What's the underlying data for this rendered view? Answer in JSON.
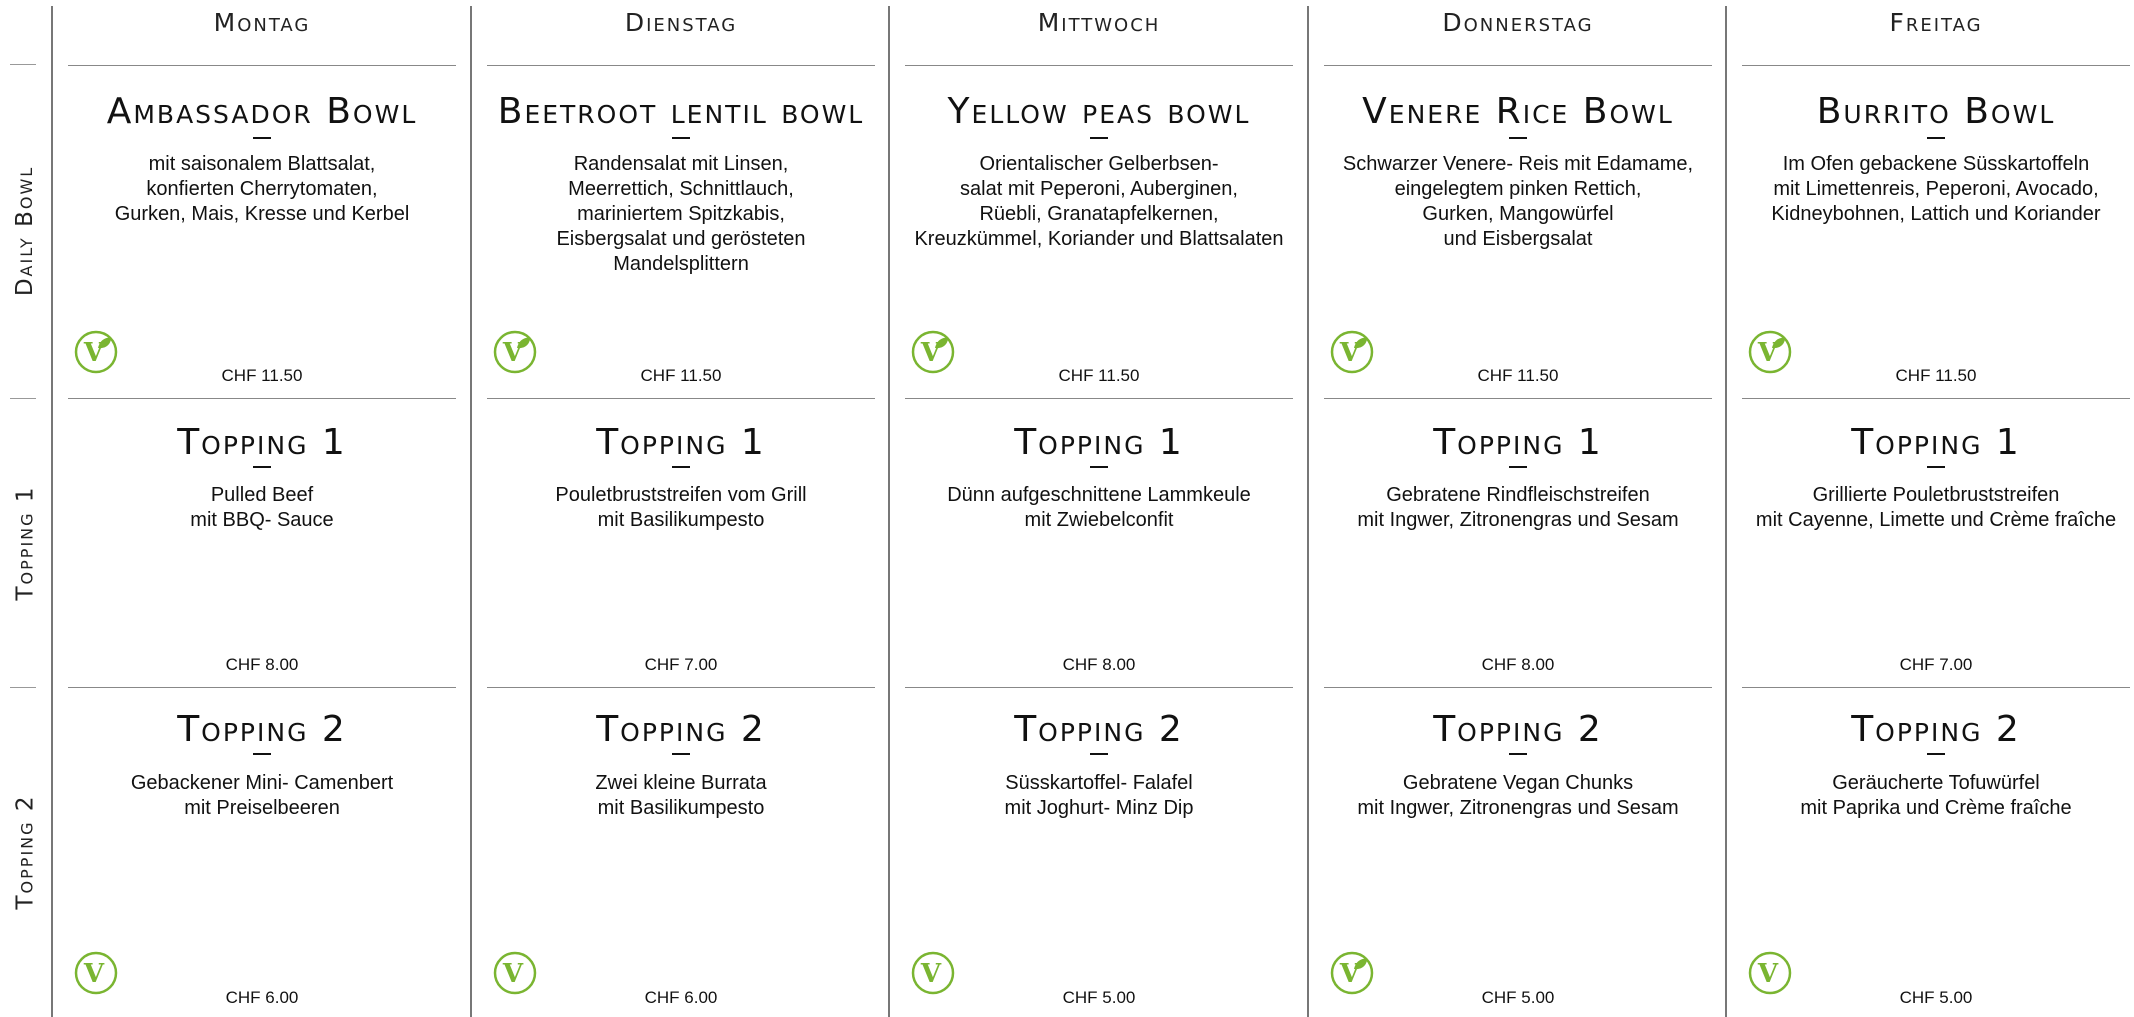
{
  "row_labels": [
    "Daily Bowl",
    "Topping 1",
    "Topping 2"
  ],
  "colors": {
    "vegan_green": "#7ab531",
    "rule": "#888888",
    "text": "#111111"
  },
  "days": [
    {
      "day": "Montag",
      "daily_bowl": {
        "title": "Ambassador Bowl",
        "description": "mit saisonalem Blattsalat,\nkonfierten Cherrytomaten,\nGurken, Mais, Kresse und Kerbel",
        "price": "CHF 11.50",
        "badge": "vegan-leaf-icon"
      },
      "topping_1": {
        "title": "Topping 1",
        "description": "Pulled Beef\nmit BBQ- Sauce",
        "price": "CHF 8.00"
      },
      "topping_2": {
        "title": "Topping 2",
        "description": "Gebackener Mini- Camenbert\nmit Preiselbeeren",
        "price": "CHF 6.00",
        "badge": "vegetarian-v-icon"
      }
    },
    {
      "day": "Dienstag",
      "daily_bowl": {
        "title": "Beetroot lentil bowl",
        "description": "Randensalat mit Linsen,\nMeerrettich, Schnittlauch,\nmariniertem Spitzkabis,\nEisbergsalat und gerösteten\nMandelsplittern",
        "price": "CHF 11.50",
        "badge": "vegan-leaf-icon"
      },
      "topping_1": {
        "title": "Topping 1",
        "description": "Pouletbruststreifen vom Grill\nmit Basilikumpesto",
        "price": "CHF 7.00"
      },
      "topping_2": {
        "title": "Topping 2",
        "description": "Zwei kleine Burrata\nmit Basilikumpesto",
        "price": "CHF 6.00",
        "badge": "vegetarian-v-icon"
      }
    },
    {
      "day": "Mittwoch",
      "daily_bowl": {
        "title": "Yellow peas bowl",
        "description": "Orientalischer Gelberbsen-\nsalat mit Peperoni, Auberginen,\nRüebli, Granatapfelkernen,\nKreuzkümmel, Koriander und Blattsalaten",
        "price": "CHF 11.50",
        "badge": "vegan-leaf-icon"
      },
      "topping_1": {
        "title": "Topping 1",
        "description": "Dünn aufgeschnittene Lammkeule\nmit Zwiebelconfit",
        "price": "CHF 8.00"
      },
      "topping_2": {
        "title": "Topping 2",
        "description": "Süsskartoffel- Falafel\nmit Joghurt- Minz Dip",
        "price": "CHF 5.00",
        "badge": "vegetarian-v-icon"
      }
    },
    {
      "day": "Donnerstag",
      "daily_bowl": {
        "title": "Venere Rice Bowl",
        "description": "Schwarzer Venere- Reis mit Edamame,\neingelegtem pinken Rettich,\nGurken, Mangowürfel\nund Eisbergsalat",
        "price": "CHF 11.50",
        "badge": "vegan-leaf-icon"
      },
      "topping_1": {
        "title": "Topping 1",
        "description": "Gebratene Rindfleischstreifen\nmit Ingwer, Zitronengras und Sesam",
        "price": "CHF 8.00"
      },
      "topping_2": {
        "title": "Topping 2",
        "description": "Gebratene Vegan Chunks\nmit Ingwer, Zitronengras und Sesam",
        "price": "CHF 5.00",
        "badge": "vegan-leaf-icon"
      }
    },
    {
      "day": "Freitag",
      "daily_bowl": {
        "title": "Burrito Bowl",
        "description": "Im Ofen gebackene Süsskartoffeln\nmit Limettenreis, Peperoni, Avocado,\nKidneybohnen, Lattich und Koriander",
        "price": "CHF 11.50",
        "badge": "vegan-leaf-icon"
      },
      "topping_1": {
        "title": "Topping 1",
        "description": "Grillierte Pouletbruststreifen\nmit Cayenne, Limette und Crème fraîche",
        "price": "CHF 7.00"
      },
      "topping_2": {
        "title": "Topping 2",
        "description": "Geräucherte Tofuwürfel\nmit Paprika und Crème fraîche",
        "price": "CHF 5.00",
        "badge": "vegetarian-v-icon"
      }
    }
  ]
}
